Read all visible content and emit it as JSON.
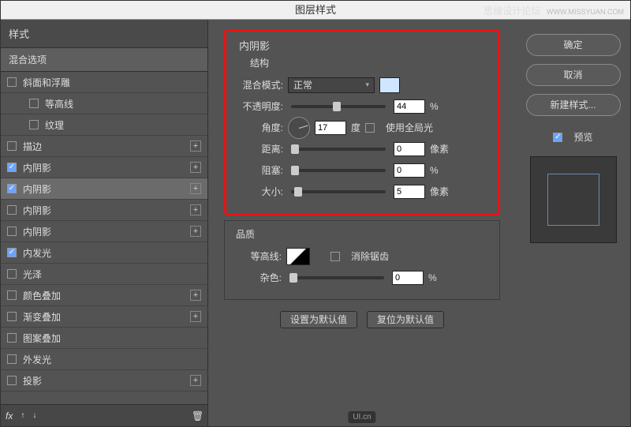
{
  "title": "图层样式",
  "watermark": {
    "site": "思缘设计论坛",
    "url": "WWW.MISSYUAN.COM"
  },
  "left": {
    "header": "样式",
    "blend": "混合选项",
    "items": [
      {
        "label": "斜面和浮雕",
        "checked": false,
        "indent": false,
        "plus": false
      },
      {
        "label": "等高线",
        "checked": false,
        "indent": true,
        "plus": false
      },
      {
        "label": "纹理",
        "checked": false,
        "indent": true,
        "plus": false
      },
      {
        "label": "描边",
        "checked": false,
        "indent": false,
        "plus": true
      },
      {
        "label": "内阴影",
        "checked": true,
        "indent": false,
        "plus": true,
        "sel": false
      },
      {
        "label": "内阴影",
        "checked": true,
        "indent": false,
        "plus": true,
        "sel": true
      },
      {
        "label": "内阴影",
        "checked": false,
        "indent": false,
        "plus": true
      },
      {
        "label": "内阴影",
        "checked": false,
        "indent": false,
        "plus": true
      },
      {
        "label": "内发光",
        "checked": true,
        "indent": false,
        "plus": false
      },
      {
        "label": "光泽",
        "checked": false,
        "indent": false,
        "plus": false
      },
      {
        "label": "颜色叠加",
        "checked": false,
        "indent": false,
        "plus": true
      },
      {
        "label": "渐变叠加",
        "checked": false,
        "indent": false,
        "plus": true
      },
      {
        "label": "图案叠加",
        "checked": false,
        "indent": false,
        "plus": false
      },
      {
        "label": "外发光",
        "checked": false,
        "indent": false,
        "plus": false
      },
      {
        "label": "投影",
        "checked": false,
        "indent": false,
        "plus": true
      }
    ],
    "fx": "fx"
  },
  "panel": {
    "title": "内阴影",
    "structure": "结构",
    "blendmode_label": "混合模式:",
    "blendmode_value": "正常",
    "opacity_label": "不透明度:",
    "opacity_value": "44",
    "opacity_unit": "%",
    "angle_label": "角度:",
    "angle_value": "17",
    "angle_unit": "度",
    "global_light": "使用全局光",
    "distance_label": "距离:",
    "distance_value": "0",
    "distance_unit": "像素",
    "choke_label": "阻塞:",
    "choke_value": "0",
    "choke_unit": "%",
    "size_label": "大小:",
    "size_value": "5",
    "size_unit": "像素",
    "quality": "品质",
    "contour_label": "等高线:",
    "antialias": "消除锯齿",
    "noise_label": "杂色:",
    "noise_value": "0",
    "noise_unit": "%",
    "make_default": "设置为默认值",
    "reset_default": "复位为默认值"
  },
  "right": {
    "ok": "确定",
    "cancel": "取消",
    "newstyle": "新建样式...",
    "preview": "预览"
  },
  "logo": "UI.cn"
}
